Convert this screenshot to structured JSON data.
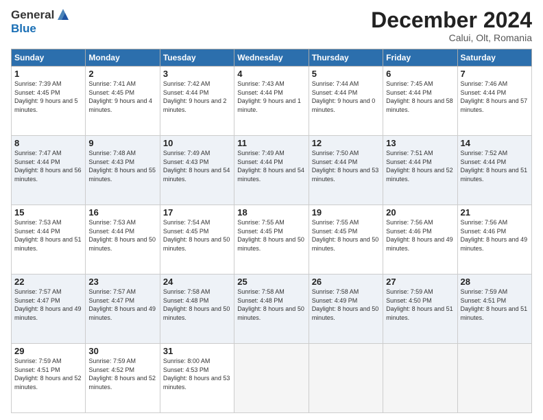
{
  "header": {
    "logo_line1": "General",
    "logo_line2": "Blue",
    "month_title": "December 2024",
    "location": "Calui, Olt, Romania"
  },
  "weekdays": [
    "Sunday",
    "Monday",
    "Tuesday",
    "Wednesday",
    "Thursday",
    "Friday",
    "Saturday"
  ],
  "weeks": [
    [
      {
        "day": "1",
        "sunrise": "7:39 AM",
        "sunset": "4:45 PM",
        "daylight": "9 hours and 5 minutes."
      },
      {
        "day": "2",
        "sunrise": "7:41 AM",
        "sunset": "4:45 PM",
        "daylight": "9 hours and 4 minutes."
      },
      {
        "day": "3",
        "sunrise": "7:42 AM",
        "sunset": "4:44 PM",
        "daylight": "9 hours and 2 minutes."
      },
      {
        "day": "4",
        "sunrise": "7:43 AM",
        "sunset": "4:44 PM",
        "daylight": "9 hours and 1 minute."
      },
      {
        "day": "5",
        "sunrise": "7:44 AM",
        "sunset": "4:44 PM",
        "daylight": "9 hours and 0 minutes."
      },
      {
        "day": "6",
        "sunrise": "7:45 AM",
        "sunset": "4:44 PM",
        "daylight": "8 hours and 58 minutes."
      },
      {
        "day": "7",
        "sunrise": "7:46 AM",
        "sunset": "4:44 PM",
        "daylight": "8 hours and 57 minutes."
      }
    ],
    [
      {
        "day": "8",
        "sunrise": "7:47 AM",
        "sunset": "4:44 PM",
        "daylight": "8 hours and 56 minutes."
      },
      {
        "day": "9",
        "sunrise": "7:48 AM",
        "sunset": "4:43 PM",
        "daylight": "8 hours and 55 minutes."
      },
      {
        "day": "10",
        "sunrise": "7:49 AM",
        "sunset": "4:43 PM",
        "daylight": "8 hours and 54 minutes."
      },
      {
        "day": "11",
        "sunrise": "7:49 AM",
        "sunset": "4:44 PM",
        "daylight": "8 hours and 54 minutes."
      },
      {
        "day": "12",
        "sunrise": "7:50 AM",
        "sunset": "4:44 PM",
        "daylight": "8 hours and 53 minutes."
      },
      {
        "day": "13",
        "sunrise": "7:51 AM",
        "sunset": "4:44 PM",
        "daylight": "8 hours and 52 minutes."
      },
      {
        "day": "14",
        "sunrise": "7:52 AM",
        "sunset": "4:44 PM",
        "daylight": "8 hours and 51 minutes."
      }
    ],
    [
      {
        "day": "15",
        "sunrise": "7:53 AM",
        "sunset": "4:44 PM",
        "daylight": "8 hours and 51 minutes."
      },
      {
        "day": "16",
        "sunrise": "7:53 AM",
        "sunset": "4:44 PM",
        "daylight": "8 hours and 50 minutes."
      },
      {
        "day": "17",
        "sunrise": "7:54 AM",
        "sunset": "4:45 PM",
        "daylight": "8 hours and 50 minutes."
      },
      {
        "day": "18",
        "sunrise": "7:55 AM",
        "sunset": "4:45 PM",
        "daylight": "8 hours and 50 minutes."
      },
      {
        "day": "19",
        "sunrise": "7:55 AM",
        "sunset": "4:45 PM",
        "daylight": "8 hours and 50 minutes."
      },
      {
        "day": "20",
        "sunrise": "7:56 AM",
        "sunset": "4:46 PM",
        "daylight": "8 hours and 49 minutes."
      },
      {
        "day": "21",
        "sunrise": "7:56 AM",
        "sunset": "4:46 PM",
        "daylight": "8 hours and 49 minutes."
      }
    ],
    [
      {
        "day": "22",
        "sunrise": "7:57 AM",
        "sunset": "4:47 PM",
        "daylight": "8 hours and 49 minutes."
      },
      {
        "day": "23",
        "sunrise": "7:57 AM",
        "sunset": "4:47 PM",
        "daylight": "8 hours and 49 minutes."
      },
      {
        "day": "24",
        "sunrise": "7:58 AM",
        "sunset": "4:48 PM",
        "daylight": "8 hours and 50 minutes."
      },
      {
        "day": "25",
        "sunrise": "7:58 AM",
        "sunset": "4:48 PM",
        "daylight": "8 hours and 50 minutes."
      },
      {
        "day": "26",
        "sunrise": "7:58 AM",
        "sunset": "4:49 PM",
        "daylight": "8 hours and 50 minutes."
      },
      {
        "day": "27",
        "sunrise": "7:59 AM",
        "sunset": "4:50 PM",
        "daylight": "8 hours and 51 minutes."
      },
      {
        "day": "28",
        "sunrise": "7:59 AM",
        "sunset": "4:51 PM",
        "daylight": "8 hours and 51 minutes."
      }
    ],
    [
      {
        "day": "29",
        "sunrise": "7:59 AM",
        "sunset": "4:51 PM",
        "daylight": "8 hours and 52 minutes."
      },
      {
        "day": "30",
        "sunrise": "7:59 AM",
        "sunset": "4:52 PM",
        "daylight": "8 hours and 52 minutes."
      },
      {
        "day": "31",
        "sunrise": "8:00 AM",
        "sunset": "4:53 PM",
        "daylight": "8 hours and 53 minutes."
      },
      null,
      null,
      null,
      null
    ]
  ]
}
